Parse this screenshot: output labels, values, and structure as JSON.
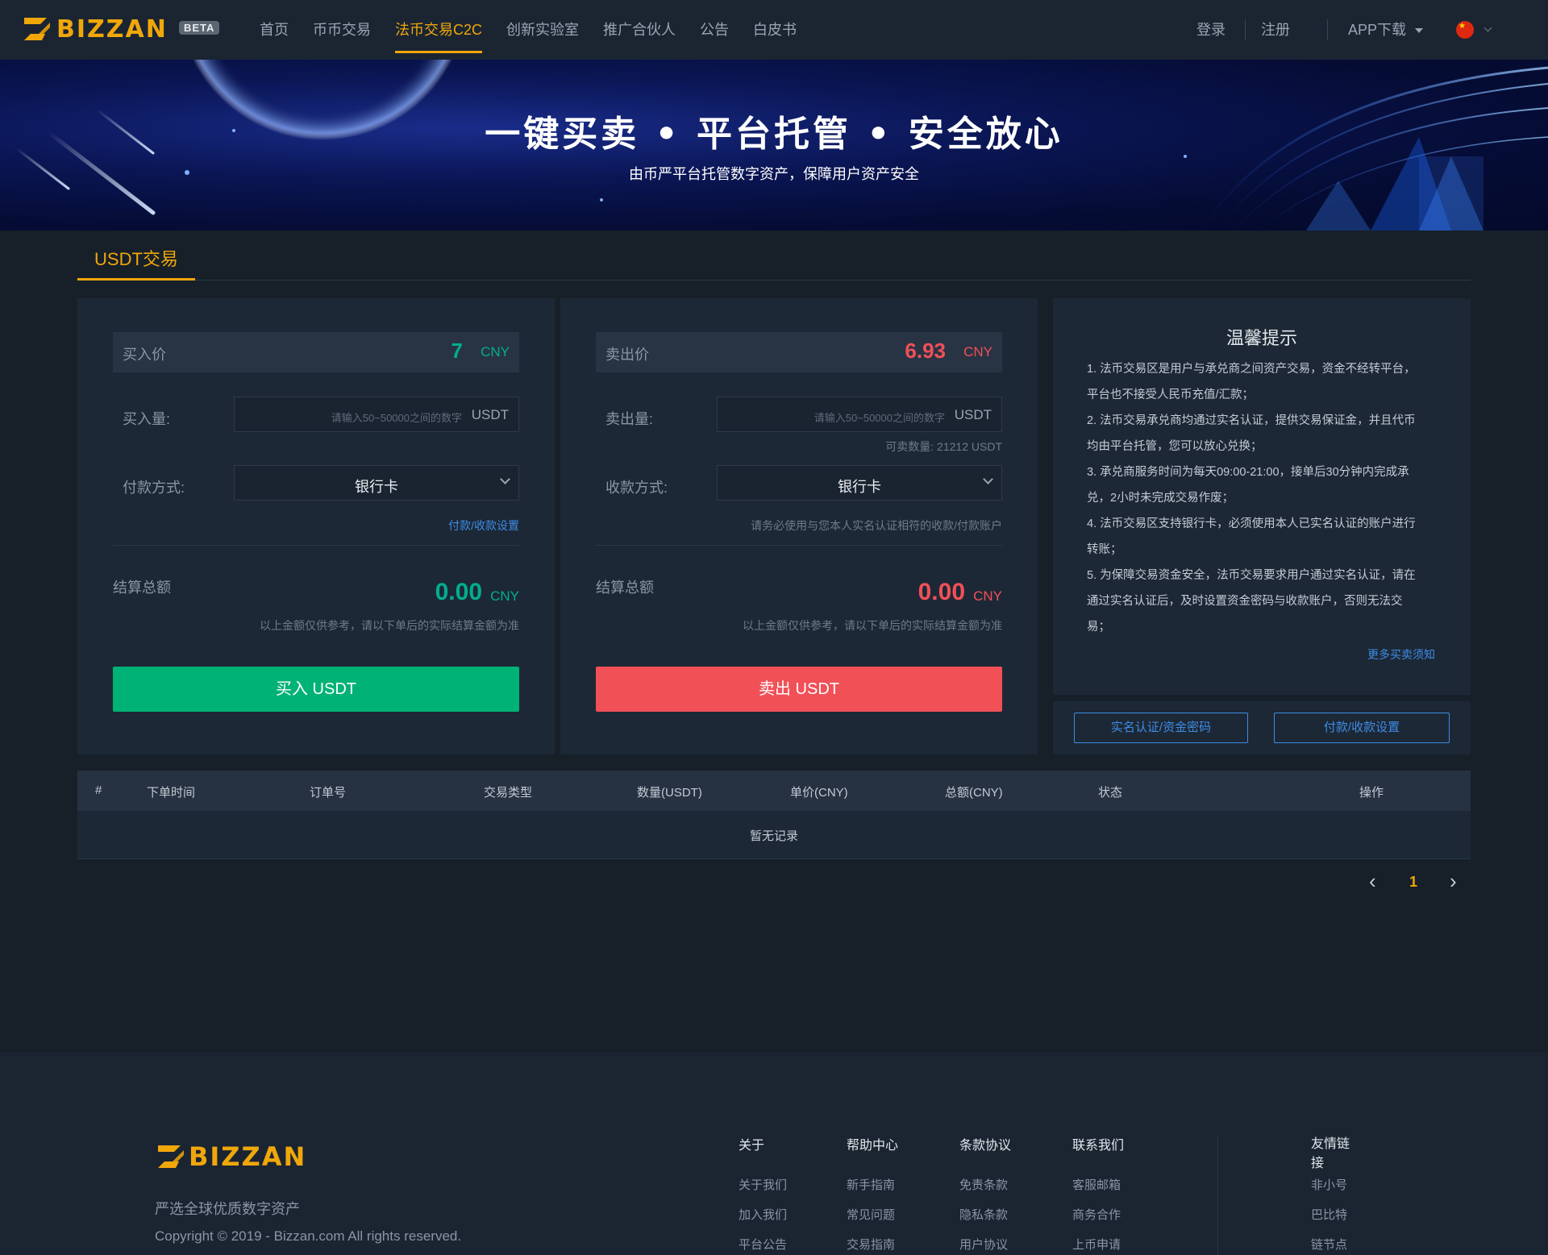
{
  "nav": {
    "logo_text": "BIZZAN",
    "beta": "BETA",
    "menu": [
      {
        "label": "首页",
        "active": false
      },
      {
        "label": "币币交易",
        "active": false
      },
      {
        "label": "法币交易C2C",
        "active": true
      },
      {
        "label": "创新实验室",
        "active": false
      },
      {
        "label": "推广合伙人",
        "active": false
      },
      {
        "label": "公告",
        "active": false
      },
      {
        "label": "白皮书",
        "active": false
      }
    ],
    "login": "登录",
    "register": "注册",
    "app_download": "APP下载"
  },
  "banner": {
    "title": "一键买卖 • 平台托管 • 安全放心",
    "subtitle": "由币严平台托管数字资产，保障用户资产安全"
  },
  "tabs": {
    "usdt": "USDT交易"
  },
  "buy": {
    "price_label": "买入价",
    "price": "7",
    "currency": "CNY",
    "amount_label": "买入量:",
    "amount_placeholder": "请输入50~50000之间的数字",
    "amount_unit": "USDT",
    "pay_label": "付款方式:",
    "pay_method": "银行卡",
    "settings_link": "付款/收款设置",
    "total_label": "结算总额",
    "total": "0.00",
    "total_currency": "CNY",
    "note": "以上金额仅供参考，请以下单后的实际结算金额为准",
    "button": "买入 USDT"
  },
  "sell": {
    "price_label": "卖出价",
    "price": "6.93",
    "currency": "CNY",
    "amount_label": "卖出量:",
    "amount_placeholder": "请输入50~50000之间的数字",
    "amount_unit": "USDT",
    "available": "可卖数量:  21212  USDT",
    "pay_label": "收款方式:",
    "pay_method": "银行卡",
    "warning": "请务必使用与您本人实名认证相符的收款/付款账户",
    "total_label": "结算总额",
    "total": "0.00",
    "total_currency": "CNY",
    "note": "以上金额仅供参考，请以下单后的实际结算金额为准",
    "button": "卖出 USDT"
  },
  "tips": {
    "title": "温馨提示",
    "lines": [
      "1. 法币交易区是用户与承兑商之间资产交易，资金不经转平台，",
      "平台也不接受人民币充值/汇款；",
      "2. 法币交易承兑商均通过实名认证，提供交易保证金，并且代币",
      "均由平台托管，您可以放心兑换；",
      "3. 承兑商服务时间为每天09:00-21:00，接单后30分钟内完成承",
      "兑，2小时未完成交易作废；",
      "4. 法币交易区支持银行卡，必须使用本人已实名认证的账户进行",
      "转账；",
      "5. 为保障交易资金安全，法币交易要求用户通过实名认证，请在",
      "通过实名认证后，及时设置资金密码与收款账户，否则无法交",
      "易；"
    ],
    "more_link": "更多买卖须知",
    "btn_verify": "实名认证/资金密码",
    "btn_payment": "付款/收款设置"
  },
  "table": {
    "headers": [
      "#",
      "下单时间",
      "订单号",
      "交易类型",
      "数量(USDT)",
      "单价(CNY)",
      "总额(CNY)",
      "状态",
      "操作"
    ],
    "empty": "暂无记录"
  },
  "pager": {
    "prev": "‹",
    "page": "1",
    "next": "›"
  },
  "footer": {
    "logo_text": "BIZZAN",
    "slogan": "严选全球优质数字资产",
    "copyright": "Copyright © 2019 - Bizzan.com All rights reserved.",
    "columns": [
      {
        "title": "关于",
        "items": [
          "关于我们",
          "加入我们",
          "平台公告"
        ]
      },
      {
        "title": "帮助中心",
        "items": [
          "新手指南",
          "常见问题",
          "交易指南"
        ]
      },
      {
        "title": "条款协议",
        "items": [
          "免责条款",
          "隐私条款",
          "用户协议"
        ]
      },
      {
        "title": "联系我们",
        "items": [
          "客服邮箱",
          "商务合作",
          "上币申请"
        ]
      }
    ],
    "links_title": "友情链接",
    "links": [
      "非小号",
      "巴比特",
      "链节点"
    ]
  },
  "colors": {
    "accent": "#f0a70a",
    "buy_green": "#00b275",
    "sell_red": "#f15057",
    "link_blue": "#3d8ce6"
  }
}
